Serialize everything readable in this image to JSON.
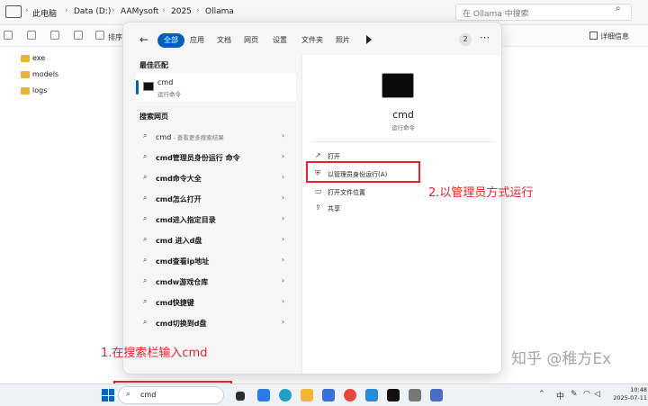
{
  "explorer": {
    "breadcrumbs": [
      "此电脑",
      "Data (D:)",
      "AAMysoft",
      "2025",
      "Ollama"
    ],
    "search_placeholder": "在 Ollama 中搜索",
    "toolbar_sort": "排序",
    "details_label": "详细信息",
    "folders": [
      "exe",
      "models",
      "logs"
    ]
  },
  "start_panel": {
    "filters": [
      "全部",
      "应用",
      "文档",
      "网页",
      "设置",
      "文件夹",
      "照片"
    ],
    "badge": "2",
    "more": "⋯",
    "best_match_title": "最佳匹配",
    "best_match": {
      "name": "cmd",
      "subtitle": "运行命令"
    },
    "web_title": "搜索网页",
    "suggestions": [
      {
        "text": "cmd",
        "hint": " - 查看更多搜索结果"
      },
      {
        "text": "cmd管理员身份运行 命令"
      },
      {
        "text": "cmd命令大全"
      },
      {
        "text": "cmd怎么打开"
      },
      {
        "text": "cmd进入指定目录"
      },
      {
        "text": "cmd 进入d盘"
      },
      {
        "text": "cmd查看ip地址"
      },
      {
        "text": "cmdw游戏仓库"
      },
      {
        "text": "cmd快捷键"
      },
      {
        "text": "cmd切换到d盘"
      }
    ],
    "detail": {
      "name": "cmd",
      "subtitle": "运行命令",
      "actions": [
        "打开",
        "以管理员身份运行(A)",
        "打开文件位置",
        "共享"
      ]
    }
  },
  "annotations": {
    "step1": "1.在搜索栏输入cmd",
    "step2": "2.以管理员方式运行"
  },
  "taskbar": {
    "search_text": "cmd",
    "ime": "中",
    "time": "10:48",
    "date": "2025-07-11"
  },
  "watermark": "知乎 @稚方Ex",
  "colors": {
    "accent": "#005fb8",
    "annotation": "#e3232f"
  }
}
